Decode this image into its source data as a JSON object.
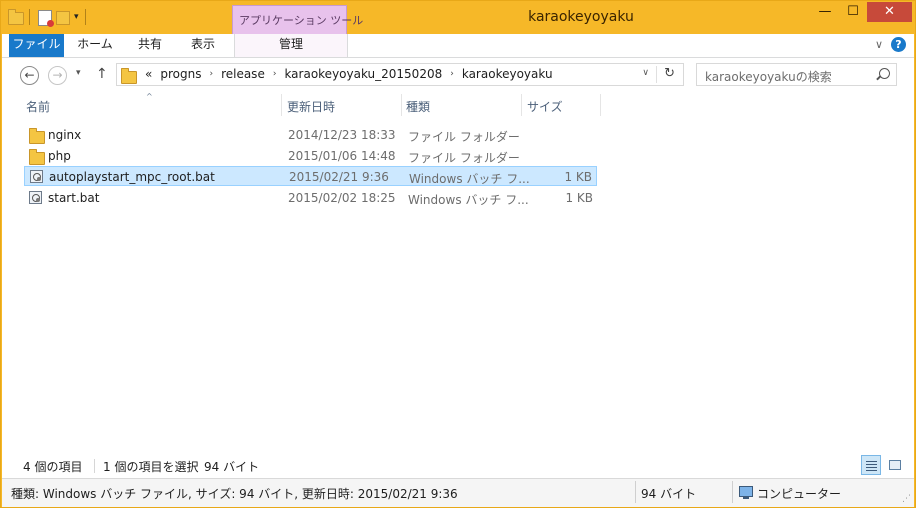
{
  "window": {
    "title": "karaokeyoyaku",
    "min_glyph": "—",
    "max_glyph": "☐",
    "close_glyph": "✕",
    "accent_color": "#f6b828"
  },
  "quick_access": {
    "dropdown_glyph": "▾"
  },
  "ribbon": {
    "context_group": "アプリケーション ツール",
    "tabs": {
      "file": "ファイル",
      "home": "ホーム",
      "share": "共有",
      "view": "表示",
      "manage": "管理"
    },
    "expand_glyph": "∨",
    "help_glyph": "?"
  },
  "nav": {
    "back_glyph": "←",
    "forward_glyph": "→",
    "recent_glyph": "▾",
    "up_glyph": "↑"
  },
  "address": {
    "overflow": "«",
    "crumbs": [
      "progns",
      "release",
      "karaokeyoyaku_20150208",
      "karaokeyoyaku"
    ],
    "separator": "›",
    "dropdown_glyph": "∨",
    "refresh_glyph": "↻"
  },
  "search": {
    "placeholder": "karaokeyoyakuの検索"
  },
  "columns": {
    "name": "名前",
    "date": "更新日時",
    "type": "種類",
    "size": "サイズ",
    "sort_glyph": "^"
  },
  "files": [
    {
      "name": "nginx",
      "date": "2014/12/23 18:33",
      "type": "ファイル フォルダー",
      "size": "",
      "icon": "folder-icon",
      "selected": false
    },
    {
      "name": "php",
      "date": "2015/01/06 14:48",
      "type": "ファイル フォルダー",
      "size": "",
      "icon": "folder-icon",
      "selected": false
    },
    {
      "name": "autoplaystart_mpc_root.bat",
      "date": "2015/02/21 9:36",
      "type": "Windows バッチ フ...",
      "size": "1 KB",
      "icon": "batch-file-icon",
      "selected": true
    },
    {
      "name": "start.bat",
      "date": "2015/02/02 18:25",
      "type": "Windows バッチ フ...",
      "size": "1 KB",
      "icon": "batch-file-icon",
      "selected": false
    }
  ],
  "status": {
    "item_count": "4 個の項目",
    "selected_count": "1 個の項目を選択",
    "selected_size": "94 バイト"
  },
  "details_bar": {
    "info": "種類: Windows バッチ ファイル, サイズ: 94 バイト, 更新日時: 2015/02/21 9:36",
    "size": "94 バイト",
    "location": "コンピューター"
  }
}
